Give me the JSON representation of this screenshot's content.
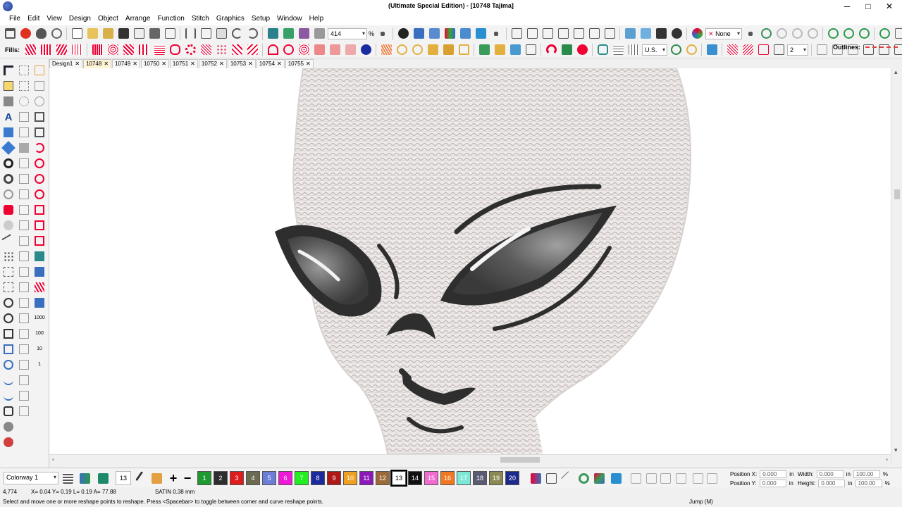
{
  "window": {
    "title": "(Ultimate Special Edition) - [10748        Tajima]",
    "minimize": "─",
    "maximize": "□",
    "close": "✕"
  },
  "menu": [
    "File",
    "Edit",
    "View",
    "Design",
    "Object",
    "Arrange",
    "Function",
    "Stitch",
    "Graphics",
    "Setup",
    "Window",
    "Help"
  ],
  "toolbar1": {
    "zoom_value": "414",
    "zoom_unit": "%",
    "none_label": "None"
  },
  "toolbar2": {
    "fills_label": "Fills:",
    "units_value": "U.S.",
    "count_value": "2",
    "outlines_label": "Outlines:"
  },
  "tabs": [
    "Design1",
    "10748",
    "10749",
    "10750",
    "10751",
    "10752",
    "10753",
    "10754",
    "10755"
  ],
  "active_tab": "10748",
  "left_numbers": [
    "1000",
    "100",
    "10",
    "1"
  ],
  "bottom": {
    "colorway": "Colorway 1",
    "thread_count": "13",
    "swatches": [
      {
        "n": "1",
        "color": "#1f9a2e"
      },
      {
        "n": "2",
        "color": "#2e2e2e"
      },
      {
        "n": "3",
        "color": "#e01b1b"
      },
      {
        "n": "4",
        "color": "#6b6b52"
      },
      {
        "n": "5",
        "color": "#6b7fd8"
      },
      {
        "n": "6",
        "color": "#f018d8"
      },
      {
        "n": "7",
        "color": "#22ee22"
      },
      {
        "n": "8",
        "color": "#1b2a9c"
      },
      {
        "n": "9",
        "color": "#b01818"
      },
      {
        "n": "10",
        "color": "#f0a020"
      },
      {
        "n": "11",
        "color": "#8c18b8"
      },
      {
        "n": "12",
        "color": "#9c6a3a"
      },
      {
        "n": "13",
        "color": "#ffffff"
      },
      {
        "n": "14",
        "color": "#111111"
      },
      {
        "n": "15",
        "color": "#f06ad0"
      },
      {
        "n": "16",
        "color": "#f07820"
      },
      {
        "n": "17",
        "color": "#7ee8d8"
      },
      {
        "n": "18",
        "color": "#5a5a72"
      },
      {
        "n": "19",
        "color": "#8a8a52"
      },
      {
        "n": "20",
        "color": "#1c2a8c"
      }
    ],
    "selected_swatch": "13",
    "position_x_label": "Position X:",
    "position_y_label": "Position Y:",
    "position_x": "0.000",
    "position_y": "0.000",
    "pos_unit": "in",
    "width_label": "Width:",
    "height_label": "Height:",
    "width": "0.000",
    "height": "0.000",
    "size_unit": "in",
    "scale_w": "100.00",
    "scale_h": "100.00",
    "pct": "%"
  },
  "status": {
    "stitch_count": "4,774",
    "coords": "X=  0.04 Y=  0.19 L=  0.19 A=  77.88",
    "stitch_type": "SATIN  0.38 mm",
    "hint": "Select and move one or more reshape points to reshape. Press <Spacebar> to toggle between corner and curve reshape points.",
    "mode": "Jump (M)"
  }
}
